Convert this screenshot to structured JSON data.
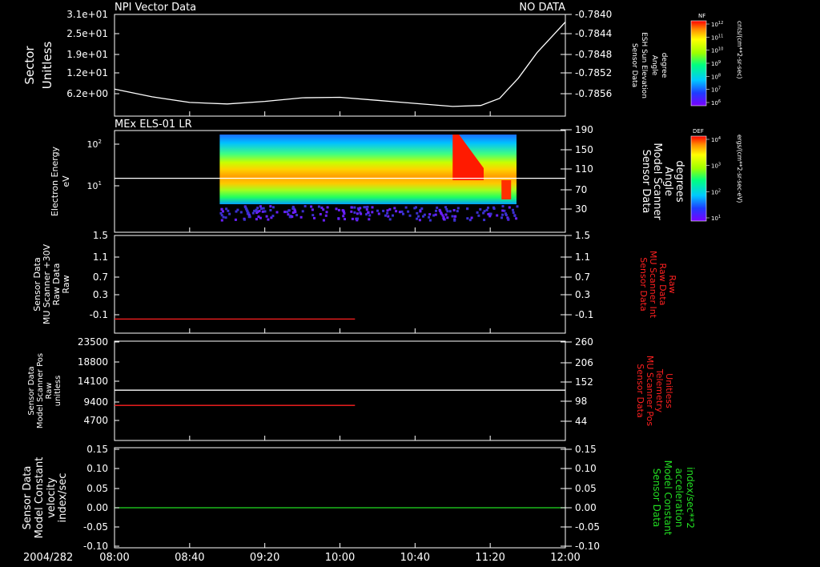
{
  "colors": {
    "background": "#000000",
    "axis": "#ffffff",
    "trace_white": "#ffffff",
    "trace_red": "#ff2020",
    "trace_green": "#22dd22",
    "label_red": "#ff2020",
    "label_green": "#22dd22"
  },
  "header": {
    "title": "NPI Vector Data",
    "status": "NO DATA"
  },
  "footer": {
    "date_label": "2004/282",
    "time_ticks": [
      "08:00",
      "08:40",
      "09:20",
      "10:00",
      "10:40",
      "11:20",
      "12:00"
    ]
  },
  "colorbars": [
    {
      "title": "NF",
      "units": "cnts/(cm**2-sr-sec)",
      "ticks": [
        "10^12",
        "10^11",
        "10^10",
        "10^9",
        "10^8",
        "10^7",
        "10^6"
      ]
    },
    {
      "title": "DEF",
      "units": "ergs/(cm**2-sr-sec-eV)",
      "ticks": [
        "10^4",
        "10^3",
        "10^2",
        "10^1"
      ]
    }
  ],
  "chart_data": [
    {
      "type": "line",
      "x_range": [
        "08:00",
        "12:00"
      ],
      "left_label": [
        "Sector",
        "Unitless"
      ],
      "left_ticks": [
        "3.1e+01",
        "2.5e+01",
        "1.9e+01",
        "1.2e+01",
        "6.2e+00"
      ],
      "right_label": [
        "Sensor Data",
        "ESH Sun Elevation",
        "Angle",
        "degree"
      ],
      "right_ticks": [
        "-0.7840",
        "-0.7844",
        "-0.7848",
        "-0.7852",
        "-0.7856"
      ],
      "ylim": [
        -0.7859,
        -0.7839
      ],
      "series": [
        {
          "color": "#ffffff",
          "x": [
            "08:00",
            "08:20",
            "08:40",
            "09:00",
            "09:20",
            "09:40",
            "10:00",
            "10:20",
            "10:40",
            "11:00",
            "11:15",
            "11:25",
            "11:35",
            "11:45",
            "11:55",
            "12:00"
          ],
          "values": [
            -0.78537,
            -0.78552,
            -0.78563,
            -0.78566,
            -0.78561,
            -0.78554,
            -0.78553,
            -0.78559,
            -0.78565,
            -0.78571,
            -0.78569,
            -0.78555,
            -0.78515,
            -0.78465,
            -0.78425,
            -0.78405
          ]
        }
      ]
    },
    {
      "type": "heatmap",
      "panel_title": "MEx ELS-01 LR",
      "x_range": [
        "08:00",
        "12:00"
      ],
      "left_label": [
        "Electron Energy",
        "eV"
      ],
      "left_ticks": [
        "10^2",
        "10^1"
      ],
      "right_label": [
        "Sensor Data",
        "Model Scanner",
        "Angle",
        "degrees"
      ],
      "right_ticks": [
        "190",
        "150",
        "110",
        "70",
        "30"
      ],
      "data_x_range": [
        "08:56",
        "11:34"
      ],
      "series": [
        {
          "color": "#ffffff",
          "x": [
            "08:00",
            "12:00"
          ],
          "values": [
            92,
            92
          ]
        }
      ]
    },
    {
      "type": "line",
      "x_range": [
        "08:00",
        "12:00"
      ],
      "left_label": [
        "Sensor Data",
        "MU Scanner +30V",
        "Raw Data",
        "Raw"
      ],
      "left_ticks": [
        "1.5",
        "1.1",
        "0.7",
        "0.3",
        "-0.1"
      ],
      "right_label": [
        "Sensor Data",
        "MU Scanner Int",
        "Raw Data",
        "Raw"
      ],
      "right_ticks": [
        "1.5",
        "1.1",
        "0.7",
        "0.3",
        "-0.1"
      ],
      "ylim": [
        -0.3,
        1.5
      ],
      "series": [
        {
          "color": "#ff2020",
          "x": [
            "08:00",
            "10:08"
          ],
          "values": [
            -0.04,
            -0.04
          ]
        }
      ]
    },
    {
      "type": "line",
      "x_range": [
        "08:00",
        "12:00"
      ],
      "left_label": [
        "Sensor Data",
        "Model Scanner Pos",
        "Raw",
        "unitless"
      ],
      "left_ticks": [
        "23500",
        "18800",
        "14100",
        "9400",
        "4700"
      ],
      "right_label": [
        "Sensor Data",
        "MU Scanner Pos",
        "Telemetry",
        "Unitless"
      ],
      "right_ticks": [
        "260",
        "206",
        "152",
        "98",
        "44"
      ],
      "ylim": [
        0,
        23500
      ],
      "series": [
        {
          "color": "#ffffff",
          "x": [
            "08:00",
            "12:00"
          ],
          "values": [
            11900,
            11900
          ]
        },
        {
          "color": "#ff2020",
          "x": [
            "08:00",
            "10:08"
          ],
          "values": [
            8300,
            8300
          ]
        }
      ]
    },
    {
      "type": "line",
      "x_range": [
        "08:00",
        "12:00"
      ],
      "left_label": [
        "Sensor Data",
        "Model Constant",
        "velocity",
        "index/sec"
      ],
      "left_ticks": [
        "0.15",
        "0.10",
        "0.05",
        "0.00",
        "-0.05",
        "-0.10"
      ],
      "right_label": [
        "Sensor Data",
        "Model Constant",
        "acceleration",
        "index/sec**2"
      ],
      "right_ticks": [
        "0.15",
        "0.10",
        "0.05",
        "0.00",
        "-0.05",
        "-0.10"
      ],
      "ylim": [
        -0.1,
        0.15
      ],
      "series": [
        {
          "color": "#22dd22",
          "x": [
            "08:00",
            "12:00"
          ],
          "values": [
            0.0,
            0.0
          ]
        }
      ]
    }
  ]
}
